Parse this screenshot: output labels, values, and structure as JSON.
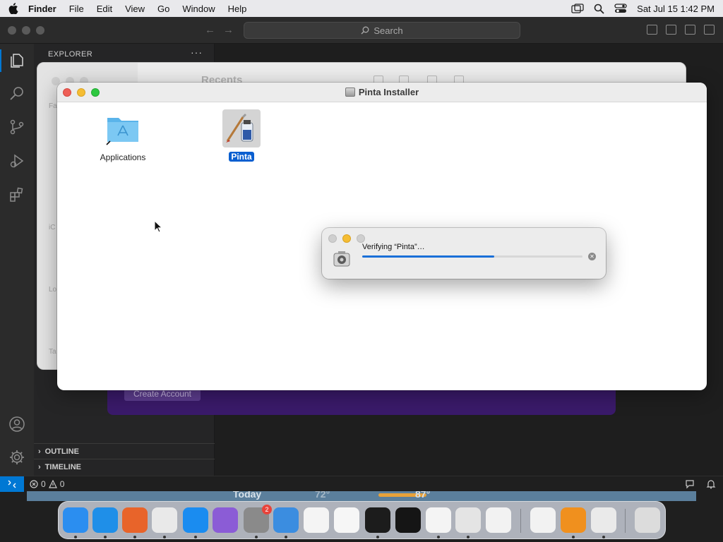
{
  "menubar": {
    "app_name": "Finder",
    "items": [
      "File",
      "Edit",
      "View",
      "Go",
      "Window",
      "Help"
    ],
    "clock": "Sat Jul 15  1:42 PM"
  },
  "vscode": {
    "search_label": "Search",
    "explorer_title": "EXPLORER",
    "more_actions": "···",
    "sections": {
      "outline": "OUTLINE",
      "timeline": "TIMELINE"
    },
    "status": {
      "errors": "0",
      "warnings": "0"
    }
  },
  "purple_window": {
    "button_label": "Create Account"
  },
  "finder_back": {
    "title": "Recents",
    "sidebar_labels": [
      "Fa",
      "iC",
      "Lo",
      "Ta"
    ]
  },
  "installer": {
    "title": "Pinta Installer",
    "items": [
      {
        "label": "Applications",
        "selected": false
      },
      {
        "label": "Pinta",
        "selected": true
      }
    ]
  },
  "verify_dialog": {
    "text": "Verifying “Pinta”…",
    "progress": 0.6
  },
  "widget": {
    "day": "Today",
    "low": "72°",
    "high": "87°"
  },
  "dock": {
    "apps": [
      {
        "name": "Finder",
        "color": "#2b8ef0",
        "running": true
      },
      {
        "name": "Safari",
        "color": "#1f8fe8",
        "running": true
      },
      {
        "name": "Firefox",
        "color": "#e8642a",
        "running": true
      },
      {
        "name": "Chrome",
        "color": "#e9e9e9",
        "running": true
      },
      {
        "name": "App Store",
        "color": "#1a8cf0",
        "running": true
      },
      {
        "name": "Podcasts-like",
        "color": "#8b5cd6",
        "running": false
      },
      {
        "name": "System Settings",
        "color": "#8a8a8a",
        "running": true,
        "badge": "2"
      },
      {
        "name": "Weather",
        "color": "#3b8de0",
        "running": true
      },
      {
        "name": "Visual Studio",
        "color": "#f4f4f4",
        "running": false
      },
      {
        "name": "TextEdit",
        "color": "#f6f6f6",
        "running": false
      },
      {
        "name": "Terminal",
        "color": "#1c1c1c",
        "running": true
      },
      {
        "name": "Console",
        "color": "#151515",
        "running": false
      },
      {
        "name": "VS Code",
        "color": "#f4f4f4",
        "running": true
      },
      {
        "name": "Preview",
        "color": "#e4e4e4",
        "running": true
      },
      {
        "name": "Launchpad",
        "color": "#f2f2f2",
        "running": false
      },
      {
        "name": "Calculator",
        "color": "#f2f2f2",
        "running": false
      },
      {
        "name": "Books",
        "color": "#f0901e",
        "running": true
      },
      {
        "name": "Pinta",
        "color": "#eaeaea",
        "running": true
      },
      {
        "name": "Trash",
        "color": "#dcdcdc",
        "running": false
      }
    ]
  }
}
